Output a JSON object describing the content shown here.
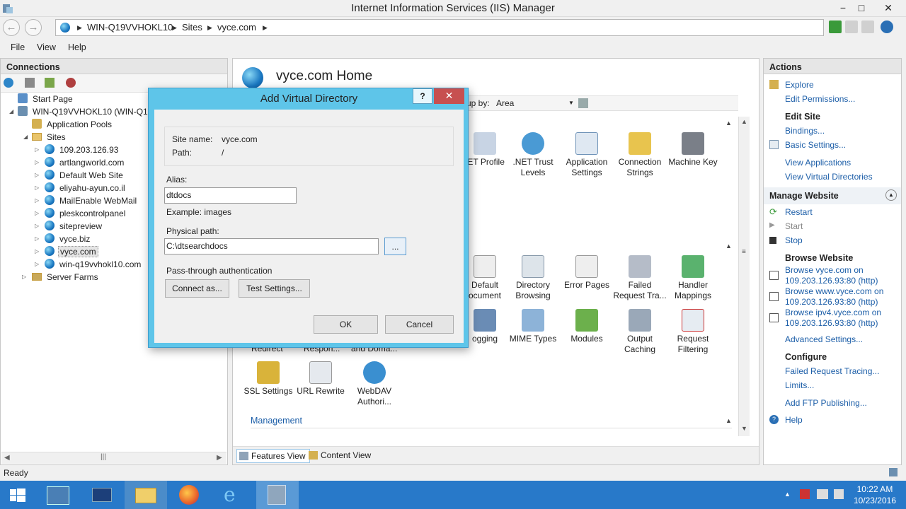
{
  "window": {
    "title": "Internet Information Services (IIS) Manager",
    "min": "−",
    "max": "□",
    "close": "✕"
  },
  "address": {
    "crumbs": [
      "WIN-Q19VVHOKL10",
      "Sites",
      "vyce.com"
    ],
    "sep": "▶"
  },
  "menu": {
    "file": "File",
    "view": "View",
    "help": "Help"
  },
  "connections": {
    "title": "Connections",
    "tree": {
      "start_page": "Start Page",
      "server": "WIN-Q19VVHOKL10 (WIN-Q19",
      "app_pools": "Application Pools",
      "sites": "Sites",
      "site_list": [
        "109.203.126.93",
        "artlangworld.com",
        "Default Web Site",
        "eliyahu-ayun.co.il",
        "MailEnable WebMail",
        "pleskcontrolpanel",
        "sitepreview",
        "vyce.biz",
        "vyce.com",
        "win-q19vvhokl10.com"
      ],
      "server_farms": "Server Farms"
    }
  },
  "center": {
    "title": "vyce.com Home",
    "group_by_label": "up by:",
    "group_by_value": "Area",
    "features_row1": [
      ".ET Profile",
      ".NET Trust Levels",
      "Application Settings",
      "Connection Strings",
      "Machine Key"
    ],
    "features_row2": [
      "Default ocument",
      "Directory Browsing",
      "Error Pages",
      "Failed Request Tra...",
      "Handler Mappings"
    ],
    "features_row3": [
      "ogging",
      "MIME Types",
      "Modules",
      "Output Caching",
      "Request Filtering"
    ],
    "features_row3_partial": [
      "Redirect",
      "Respon...",
      "and Doma..."
    ],
    "features_row4": [
      "SSL Settings",
      "URL Rewrite",
      "WebDAV Authori..."
    ],
    "section_management": "Management",
    "tabs": {
      "features": "Features View",
      "content": "Content View"
    }
  },
  "actions": {
    "title": "Actions",
    "explore": "Explore",
    "edit_permissions": "Edit Permissions...",
    "edit_site": "Edit Site",
    "bindings": "Bindings...",
    "basic_settings": "Basic Settings...",
    "view_applications": "View Applications",
    "view_virtual_dirs": "View Virtual Directories",
    "manage_website": "Manage Website",
    "restart": "Restart",
    "start": "Start",
    "stop": "Stop",
    "browse_website": "Browse Website",
    "browse1": "Browse vyce.com on 109.203.126.93:80 (http)",
    "browse2": "Browse www.vyce.com on 109.203.126.93:80 (http)",
    "browse3": "Browse ipv4.vyce.com on 109.203.126.93:80 (http)",
    "advanced_settings": "Advanced Settings...",
    "configure": "Configure",
    "failed_tracing": "Failed Request Tracing...",
    "limits": "Limits...",
    "add_ftp": "Add FTP Publishing...",
    "help": "Help"
  },
  "status": {
    "text": "Ready"
  },
  "taskbar": {
    "time": "10:22 AM",
    "date": "10/23/2016"
  },
  "dialog": {
    "title": "Add Virtual Directory",
    "help": "?",
    "close": "✕",
    "site_name_label": "Site name:",
    "site_name_value": "vyce.com",
    "path_label": "Path:",
    "path_value": "/",
    "alias_label": "Alias:",
    "alias_value": "dtdocs",
    "example": "Example: images",
    "physical_path_label": "Physical path:",
    "physical_path_value": "C:\\dtsearchdocs",
    "browse": "...",
    "passthrough": "Pass-through authentication",
    "connect_as": "Connect as...",
    "test_settings": "Test Settings...",
    "ok": "OK",
    "cancel": "Cancel"
  }
}
